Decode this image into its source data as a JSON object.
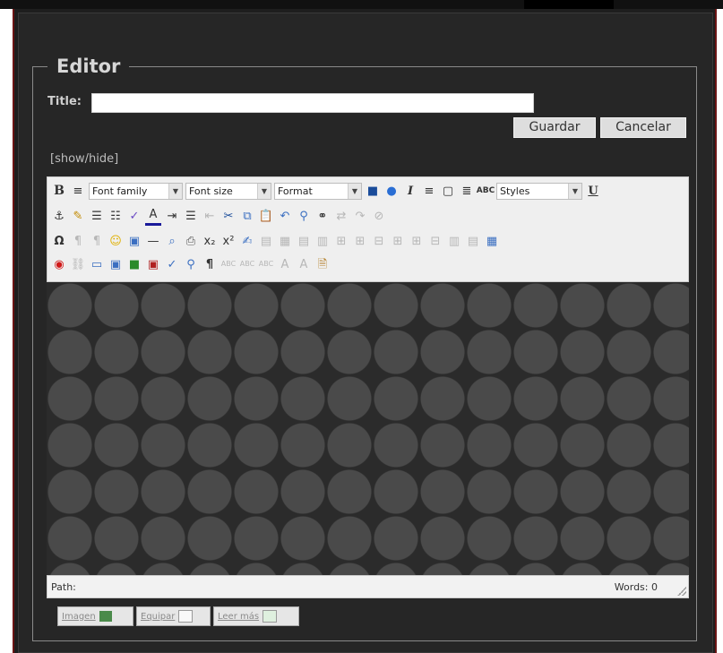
{
  "editor": {
    "legend": "Editor",
    "title_label": "Title:",
    "title_value": "",
    "buttons": {
      "save": "Guardar",
      "cancel": "Cancelar"
    },
    "show_hide": "[show/hide]"
  },
  "toolbar": {
    "font_family": "Font family",
    "font_size": "Font size",
    "format": "Format",
    "styles": "Styles",
    "row1_icons": [
      "bold-icon",
      "align-left-icon",
      "font-family-select",
      "font-size-select",
      "format-select",
      "align-center-icon",
      "help-icon",
      "italic-icon",
      "align-right-icon",
      "new-document-icon",
      "justify-icon",
      "abc-icon",
      "styles-select",
      "underline-icon"
    ],
    "row2_icons": [
      "anchor-icon",
      "highlight-icon",
      "bullet-list-icon",
      "numbered-list-icon",
      "cleanup-icon",
      "text-color-icon",
      "indent-icon",
      "list-icon",
      "outdent-icon",
      "cut-icon",
      "copy-icon",
      "paste-icon",
      "undo-icon",
      "search-icon",
      "find-icon",
      "replace-icon",
      "redo-icon",
      "unlink-icon"
    ],
    "row3_icons": [
      "omega-icon",
      "ltr-icon",
      "rtl-icon",
      "emoticon-icon",
      "media-icon",
      "hr-icon",
      "preview-icon",
      "print-icon",
      "subscript-icon",
      "superscript-icon",
      "edit-icon",
      "template-icon",
      "table-icon",
      "row-props-icon",
      "cell-props-icon",
      "insert-row-before-icon",
      "insert-row-after-icon",
      "delete-row-icon",
      "insert-col-before-icon",
      "insert-col-after-icon",
      "delete-col-icon",
      "split-cells-icon",
      "merge-cells-icon",
      "table-grid-icon"
    ],
    "row4_icons": [
      "record-icon",
      "link-icon",
      "layer-icon",
      "abs-icon",
      "image-icon",
      "html-icon",
      "spellcheck-icon",
      "find-replace-icon",
      "pilcrow-icon",
      "cite-icon",
      "abbr-icon",
      "acronym-icon",
      "del-icon",
      "ins-icon",
      "attribs-icon"
    ]
  },
  "statusbar": {
    "path": "Path:",
    "words": "Words: 0"
  },
  "bottom_buttons": [
    "Imagen",
    "Equipar",
    "Leer más"
  ],
  "colors": {
    "frame_border": "#6b1414",
    "background": "#262626",
    "toolbar": "#efefef"
  }
}
